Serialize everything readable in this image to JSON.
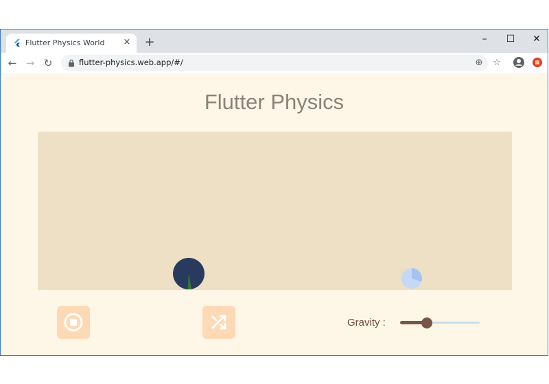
{
  "browser": {
    "tab_title": "Flutter Physics World",
    "tab_close": "×",
    "new_tab": "+",
    "url": "flutter-physics.web.app/#/",
    "window_controls": {
      "minimize": "–",
      "maximize": "☐",
      "close": "✕"
    },
    "nav": {
      "back": "←",
      "forward": "→",
      "reload": "↻"
    },
    "omnibox_icons": {
      "zoom": "⊕",
      "bookmark": "☆"
    },
    "icons": [
      "flutter-icon",
      "lock-icon",
      "account-icon",
      "extension-icon"
    ]
  },
  "page": {
    "title": "Flutter Physics",
    "controls": {
      "stop_icon": "stop-icon",
      "shuffle_icon": "shuffle-icon"
    },
    "gravity": {
      "label": "Gravity :",
      "value_fraction": 0.34
    },
    "colors": {
      "background": "#fef6e6",
      "world": "#ede0c4",
      "button": "#fdd9b5",
      "accent": "#795548",
      "ball_dark": "#283b5f",
      "ball_light": "#c5d8f5"
    }
  }
}
